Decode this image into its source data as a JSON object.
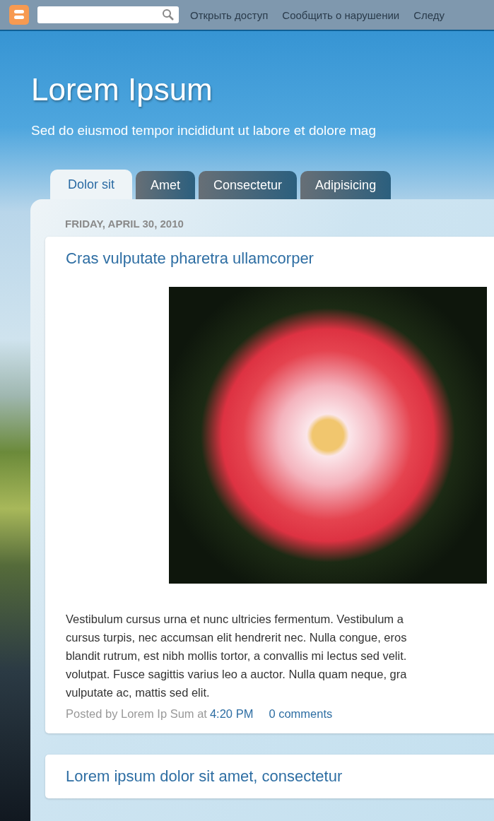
{
  "navbar": {
    "links": [
      "Открыть доступ",
      "Сообщить о нарушении",
      "Следу"
    ]
  },
  "blog": {
    "title": "Lorem Ipsum",
    "description": "Sed do eiusmod tempor incididunt ut labore et dolore mag"
  },
  "tabs": [
    {
      "label": "Dolor sit",
      "selected": true
    },
    {
      "label": "Amet",
      "selected": false
    },
    {
      "label": "Consectetur",
      "selected": false
    },
    {
      "label": "Adipisicing",
      "selected": false
    }
  ],
  "date_header": "FRIDAY, APRIL 30, 2010",
  "posts": [
    {
      "title": "Cras vulputate pharetra ullamcorper",
      "body_lines": [
        "Vestibulum cursus urna et nunc ultricies fermentum. Vestibulum a",
        "cursus turpis, nec accumsan elit hendrerit nec. Nulla congue, eros",
        "blandit rutrum, est nibh mollis tortor, a convallis mi lectus sed velit.",
        "volutpat. Fusce sagittis varius leo a auctor. Nulla quam neque, gra",
        "vulputate ac, mattis sed elit."
      ],
      "footer": {
        "posted_by": "Posted by Lorem Ip Sum at",
        "time": "4:20 PM",
        "comments": "0 comments"
      }
    },
    {
      "title": "Lorem ipsum dolor sit amet, consectetur"
    }
  ]
}
